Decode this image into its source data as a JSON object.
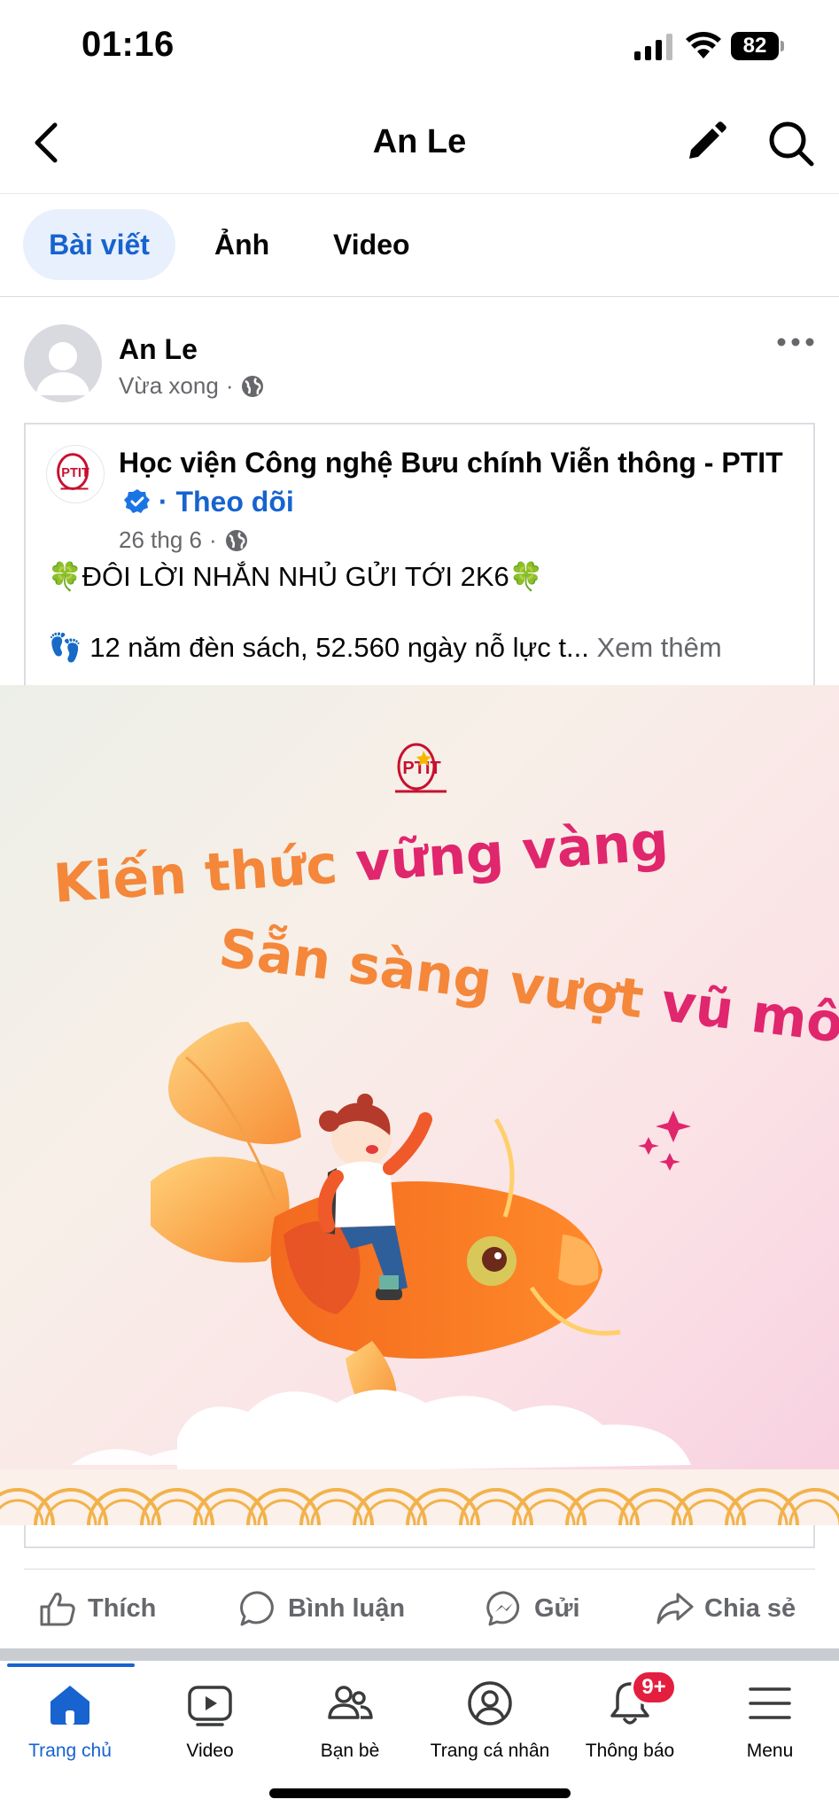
{
  "status_bar": {
    "time": "01:16",
    "battery": "82"
  },
  "header": {
    "title": "An Le"
  },
  "tabs": [
    {
      "label": "Bài viết",
      "active": true
    },
    {
      "label": "Ảnh",
      "active": false
    },
    {
      "label": "Video",
      "active": false
    }
  ],
  "post": {
    "author": "An Le",
    "time": "Vừa xong",
    "meta_separator": "·",
    "shared": {
      "page_name": "Học viện Công nghệ Bưu chính Viễn thông - PTIT",
      "follow_separator": "·",
      "follow": "Theo dõi",
      "date": "26 thg 6",
      "meta_separator": "·",
      "headline": "🍀ĐÔI LỜI NHẮN NHỦ GỬI TỚI 2K6🍀",
      "body": "👣 12 năm đèn sách, 52.560 ngày nỗ lực t...",
      "see_more": "Xem thêm",
      "image": {
        "logo_text": "PTIT",
        "line1_orange": "Kiến thức",
        "line1_pink": "vững vàng",
        "line2_orange": "Sẵn sàng vượt",
        "line2_pink": "vũ môn"
      }
    }
  },
  "actions": {
    "like": "Thích",
    "comment": "Bình luận",
    "send": "Gửi",
    "share": "Chia sẻ"
  },
  "bottom_nav": {
    "items": [
      {
        "label": "Trang chủ",
        "icon": "home-icon",
        "active": true
      },
      {
        "label": "Video",
        "icon": "video-icon",
        "active": false
      },
      {
        "label": "Bạn bè",
        "icon": "friends-icon",
        "active": false
      },
      {
        "label": "Trang cá nhân",
        "icon": "profile-icon",
        "active": false
      },
      {
        "label": "Thông báo",
        "icon": "bell-icon",
        "active": false
      },
      {
        "label": "Menu",
        "icon": "menu-icon",
        "active": false
      }
    ],
    "notification_badge": "9+"
  },
  "colors": {
    "accent": "#1763cf",
    "badge": "#e41e3f",
    "muted": "#65676b",
    "slogan_orange": "#f4873a",
    "slogan_pink": "#e0266d"
  }
}
